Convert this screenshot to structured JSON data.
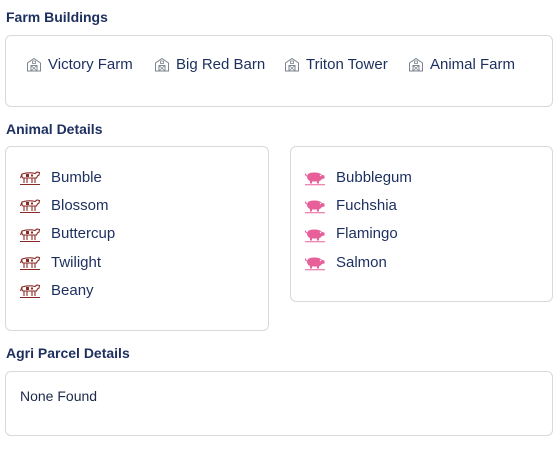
{
  "farm_buildings": {
    "title": "Farm Buildings",
    "items": [
      {
        "label": "Victory Farm",
        "icon": "farm-building-icon"
      },
      {
        "label": "Big Red Barn",
        "icon": "farm-building-icon"
      },
      {
        "label": "Triton Tower",
        "icon": "farm-building-icon"
      },
      {
        "label": "Animal Farm",
        "icon": "farm-building-icon"
      }
    ]
  },
  "animal_details": {
    "title": "Animal Details",
    "cows": {
      "icon": "cow-icon",
      "icon_color": "#8b2a25",
      "items": [
        "Bumble",
        "Blossom",
        "Buttercup",
        "Twilight",
        "Beany"
      ]
    },
    "pigs": {
      "icon": "pig-icon",
      "icon_color": "#e8609a",
      "items": [
        "Bubblegum",
        "Fuchshia",
        "Flamingo",
        "Salmon"
      ]
    }
  },
  "agri_parcel": {
    "title": "Agri Parcel Details",
    "empty_text": "None Found"
  }
}
